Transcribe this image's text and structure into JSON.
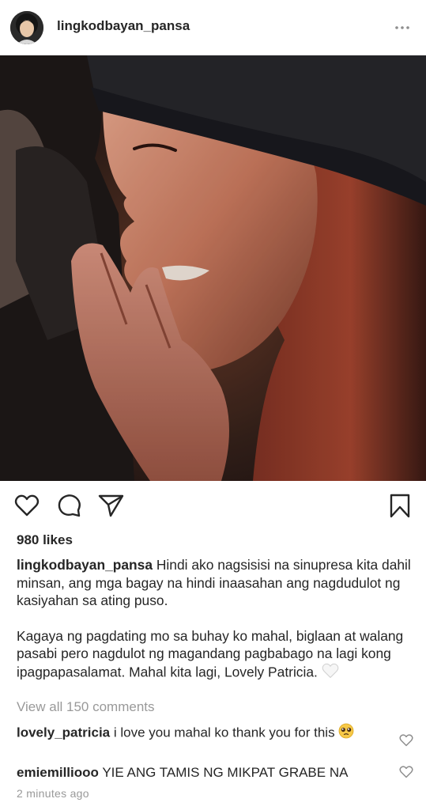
{
  "post": {
    "username": "lingkodbayan_pansa",
    "likes": "980 likes",
    "caption_user": "lingkodbayan_pansa",
    "caption_p1": "Hindi ako nagsisisi na sinupresa kita dahil minsan, ang mga bagay na hindi inaasahan ang nagdudulot ng kasiyahan sa ating puso.",
    "caption_p2": "Kagaya ng pagdating mo sa buhay ko mahal, biglaan at walang pasabi pero nagdulot ng magandang pagbabago na lagi kong ipagpapasalamat. Mahal kita lagi, Lovely Patricia.",
    "view_all": "View all 150 comments",
    "time": "2 minutes ago"
  },
  "comments": [
    {
      "user": "lovely_patricia",
      "text": "i love you mahal ko thank you for this"
    },
    {
      "user": "emiemilliooo",
      "text": "YIE ANG TAMIS NG MIKPAT GRABE NA"
    }
  ],
  "icons": {
    "more": "more-options-icon",
    "like": "heart-icon",
    "comment": "comment-icon",
    "share": "share-icon",
    "save": "bookmark-icon",
    "caption_emoji": "white-heart-icon",
    "comment_emoji": "pleading-face-icon"
  }
}
